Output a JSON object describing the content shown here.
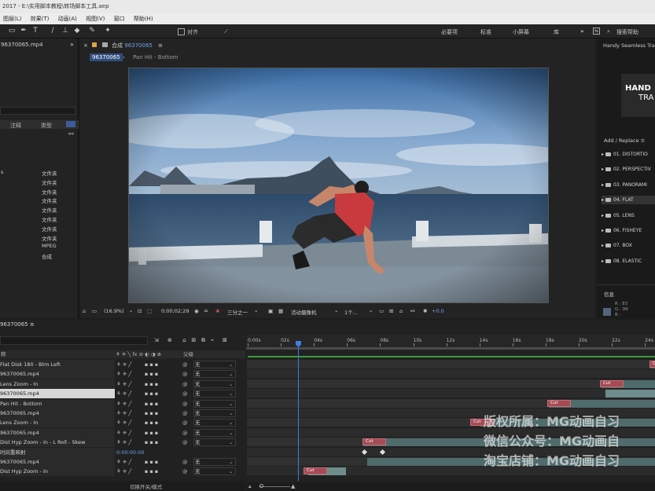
{
  "title_bar": {
    "text": "2017 - E:\\实用脚本教程\\转场脚本工具.aep"
  },
  "menu": [
    "图层(L)",
    "效果(T)",
    "动画(A)",
    "视图(V)",
    "窗口",
    "帮助(H)"
  ],
  "toolbar": {
    "snap_label": "对齐",
    "workspaces": [
      "必要项",
      "标准",
      "小屏幕",
      "库"
    ],
    "search_help": "搜索帮助"
  },
  "project": {
    "item_name": "96370065.mp4",
    "col_note": "注释",
    "col_type": "类型",
    "rows": [
      {
        "name": "s",
        "type": "文件夹"
      },
      {
        "name": "",
        "type": "文件夹"
      },
      {
        "name": "",
        "type": "文件夹"
      },
      {
        "name": "",
        "type": "文件夹"
      },
      {
        "name": "",
        "type": "文件夹"
      },
      {
        "name": "",
        "type": "文件夹"
      },
      {
        "name": "",
        "type": "文件夹"
      },
      {
        "name": "",
        "type": "文件夹"
      },
      {
        "name": "",
        "type": "MPEG"
      },
      {
        "name": "",
        "type": "合成"
      }
    ]
  },
  "composition": {
    "tab_label": "合成",
    "tab_name": "96370065",
    "breadcrumb_active": "96370065",
    "breadcrumb_next": "Pan Hit - Bottom",
    "footer": {
      "zoom": "(16.9%)",
      "timecode": "0;00;02;29",
      "resolution": "三分之一",
      "camera": "活动摄像机",
      "views": "1个...",
      "exposure": "+0.0"
    }
  },
  "right_panel": {
    "title": "Handy Seamless Tra",
    "logo_line1": "HAND",
    "logo_line2": "TRA",
    "add_replace": "Add / Replace",
    "items": [
      "01. DISTORTIO",
      "02. PERSPECTIV",
      "03. PANORAMI",
      "04. FLAT",
      "05. LENS",
      "06. FISHEYE",
      "07. BOX",
      "08. ELASTIC"
    ],
    "info_title": "信息",
    "info": {
      "r": "R : 83",
      "g": "G : 99",
      "b": "B :"
    }
  },
  "timeline": {
    "tab_name": "96370065",
    "header_name": "称",
    "header_mode": "父级",
    "parent_value": "无",
    "bottom_label": "切换开关/模式",
    "ruler_ticks": [
      "0:00s",
      "02s",
      "04s",
      "06s",
      "08s",
      "10s",
      "12s",
      "14s",
      "16s",
      "18s",
      "20s",
      "22s",
      "24s"
    ],
    "layers": [
      {
        "name": "Flat Disk 180 - Btm Left",
        "parent": "无"
      },
      {
        "name": "96370065.mp4",
        "parent": "无"
      },
      {
        "name": "Lens Zoom - In",
        "parent": "无"
      },
      {
        "name": "96370065.mp4",
        "parent": "无"
      },
      {
        "name": "Pan Hit - Bottom",
        "parent": "无"
      },
      {
        "name": "96370065.mp4",
        "parent": "无"
      },
      {
        "name": "Lens Zoom - In",
        "parent": "无"
      },
      {
        "name": "96370065.mp4",
        "parent": "无"
      },
      {
        "name": "Dist Hyp Zoom - In - L Roll - Skew",
        "parent": "无"
      },
      {
        "name": "时间重映射",
        "parent": "",
        "timecode": "0:00:00:00"
      },
      {
        "name": "96370065.mp4",
        "parent": "无"
      },
      {
        "name": "Dist Hyp Zoom - In",
        "parent": "无"
      }
    ],
    "cut_label": "Cut"
  },
  "watermark": [
    "版权所属：MG动画自习",
    "微信公众号：MG动画自",
    "淘宝店铺：MG动画自习"
  ]
}
